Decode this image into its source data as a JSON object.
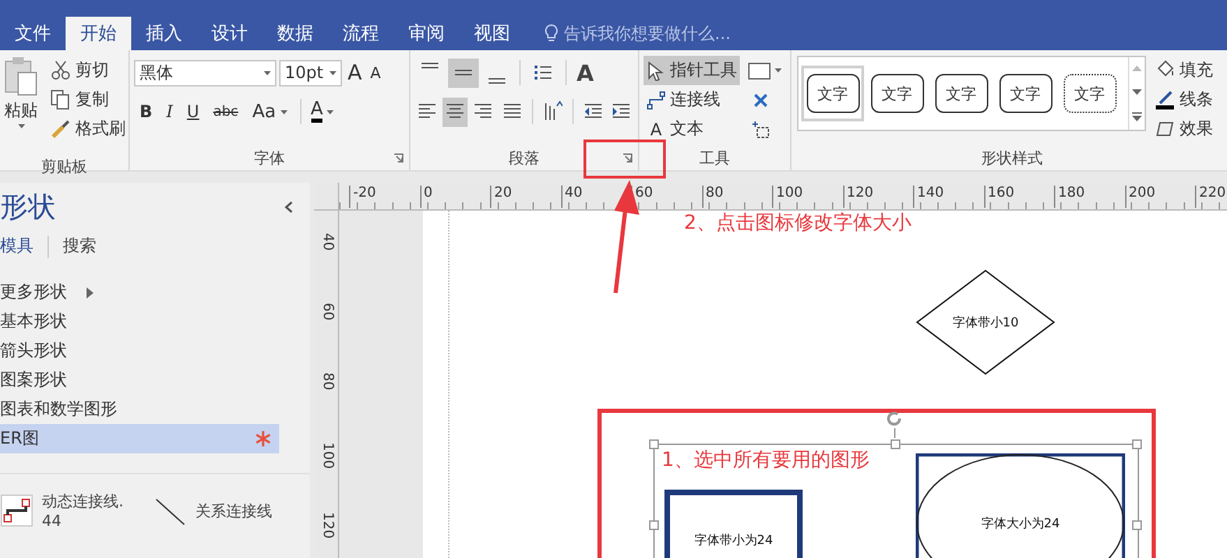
{
  "tabs": [
    {
      "label": "文件",
      "selected": false
    },
    {
      "label": "开始",
      "selected": true
    },
    {
      "label": "插入",
      "selected": false
    },
    {
      "label": "设计",
      "selected": false
    },
    {
      "label": "数据",
      "selected": false
    },
    {
      "label": "流程",
      "selected": false
    },
    {
      "label": "审阅",
      "selected": false
    },
    {
      "label": "视图",
      "selected": false
    }
  ],
  "tell_me": {
    "placeholder": "告诉我你想要做什么..."
  },
  "ribbon": {
    "clipboard": {
      "label": "剪贴板",
      "paste": "粘贴",
      "items": [
        {
          "label": "剪切",
          "kind": "cut"
        },
        {
          "label": "复制",
          "kind": "copy"
        },
        {
          "label": "格式刷",
          "kind": "format-painter"
        }
      ]
    },
    "font": {
      "label": "字体",
      "font_name": "黑体",
      "font_size": "10pt",
      "grow": "A",
      "shrink": "A",
      "format": [
        {
          "label": "B",
          "kind": "bold"
        },
        {
          "label": "I",
          "kind": "italic"
        },
        {
          "label": "U",
          "kind": "underline"
        },
        {
          "label": "abc",
          "kind": "strikethrough"
        },
        {
          "label": "Aa",
          "kind": "case"
        }
      ],
      "font_color": "A"
    },
    "paragraph": {
      "label": "段落",
      "vertical_align": [
        {
          "selected": false
        },
        {
          "selected": true
        },
        {
          "selected": false
        }
      ],
      "horizontal_align": [
        {
          "selected": false
        },
        {
          "selected": true
        },
        {
          "selected": false
        },
        {
          "selected": false
        }
      ],
      "text_direction": "A"
    },
    "tools": {
      "label": "工具",
      "items": [
        {
          "label": "指针工具",
          "kind": "pointer",
          "selected": true
        },
        {
          "label": "连接线",
          "kind": "connector",
          "selected": false
        },
        {
          "label": "文本",
          "kind": "text",
          "icon_text": "A",
          "selected": false
        }
      ]
    },
    "shape_styles": {
      "label": "形状样式",
      "styles": [
        {
          "label": "文字",
          "kind": "solid",
          "selected": true
        },
        {
          "label": "文字",
          "kind": "solid",
          "selected": false
        },
        {
          "label": "文字",
          "kind": "solid",
          "selected": false
        },
        {
          "label": "文字",
          "kind": "solid",
          "selected": false
        },
        {
          "label": "文字",
          "kind": "dashed",
          "selected": false
        }
      ],
      "options": [
        {
          "label": "填充",
          "kind": "fill"
        },
        {
          "label": "线条",
          "kind": "line"
        },
        {
          "label": "效果",
          "kind": "effect"
        }
      ]
    }
  },
  "shapes_panel": {
    "title": "形状",
    "tabs": [
      {
        "label": "模具",
        "selected": true
      },
      {
        "label": "搜索",
        "selected": false
      }
    ],
    "items": [
      {
        "label": "更多形状",
        "kind": "submenu",
        "selected": false
      },
      {
        "label": "基本形状",
        "kind": "stencil",
        "selected": false
      },
      {
        "label": "箭头形状",
        "kind": "stencil",
        "selected": false
      },
      {
        "label": "图案形状",
        "kind": "stencil",
        "selected": false
      },
      {
        "label": "图表和数学图形",
        "kind": "stencil",
        "selected": false
      },
      {
        "label": "ER图",
        "kind": "stencil",
        "selected": true
      }
    ],
    "masters": [
      {
        "label": "动态连接线.\n44",
        "kind": "dynamic-connector"
      },
      {
        "label": "关系连接线",
        "kind": "relationship-line"
      }
    ]
  },
  "rulers": {
    "horizontal": [
      "-20",
      "0",
      "20",
      "40",
      "60",
      "80",
      "100",
      "120",
      "140",
      "160",
      "180",
      "200",
      "220"
    ],
    "vertical": [
      "40",
      "60",
      "80",
      "100",
      "120"
    ]
  },
  "canvas": {
    "annotations": [
      {
        "text": "2、点击图标修改字体大小",
        "kind": "step-2"
      },
      {
        "text": "1、选中所有要用的图形",
        "kind": "step-1"
      }
    ],
    "shapes": [
      {
        "text": "字体带小10",
        "kind": "diamond"
      },
      {
        "text": "字体带小为24",
        "kind": "rectangle"
      },
      {
        "text": "字体大小为24",
        "kind": "ellipse"
      }
    ]
  }
}
